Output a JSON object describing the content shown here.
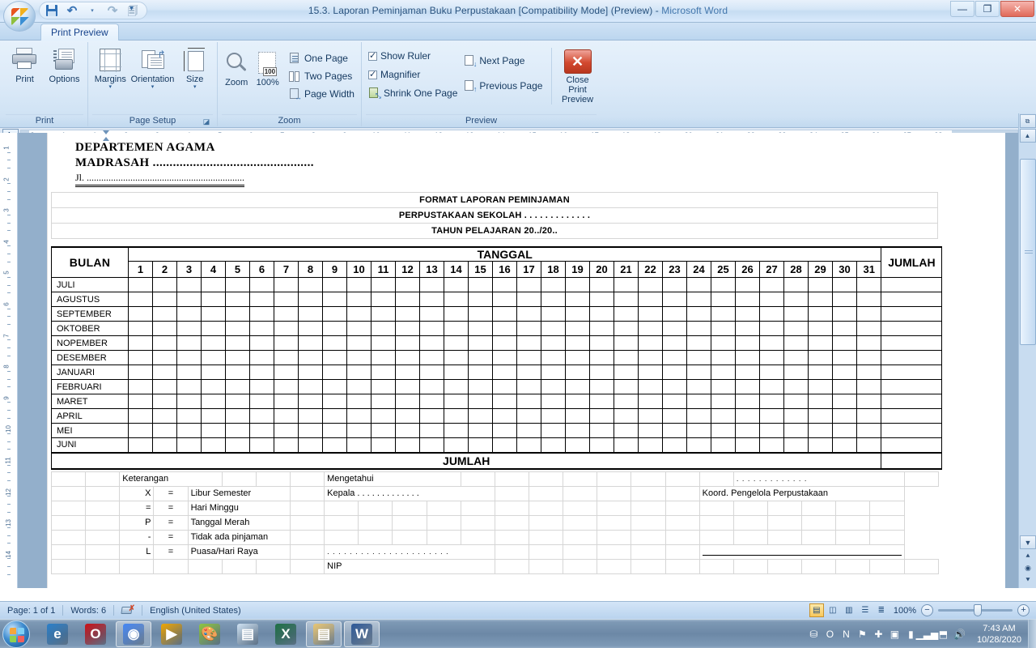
{
  "window": {
    "title": "15.3. Laporan Peminjaman Buku Perpustakaan [Compatibility Mode] (Preview) - ",
    "app_name": "Microsoft Word",
    "minimize": "—",
    "maximize": "❐",
    "close": "✕"
  },
  "quick_access": {
    "save": "save-icon",
    "undo": "↶",
    "undo_caret": "▾",
    "redo": "↷",
    "print_preview_qat": "print-preview-icon",
    "customize_caret": "▾"
  },
  "ribbon": {
    "tab": "Print Preview",
    "groups": [
      {
        "title": "Print",
        "buttons": [
          {
            "label": "Print",
            "icon": "printer-icon"
          },
          {
            "label": "Options",
            "icon": "print-options-icon"
          }
        ]
      },
      {
        "title": "Page Setup",
        "buttons": [
          {
            "label": "Margins",
            "icon": "margins-icon",
            "caret": "▾"
          },
          {
            "label": "Orientation",
            "icon": "orientation-icon",
            "caret": "▾"
          },
          {
            "label": "Size",
            "icon": "page-size-icon",
            "caret": "▾"
          }
        ],
        "dialog_launcher": "◪"
      },
      {
        "title": "Zoom",
        "buttons": [
          {
            "label": "Zoom",
            "icon": "zoom-icon"
          },
          {
            "label": "100%",
            "icon": "zoom-100-icon"
          }
        ],
        "small_buttons": [
          {
            "label": "One Page",
            "icon": "one-page-icon"
          },
          {
            "label": "Two Pages",
            "icon": "two-pages-icon"
          },
          {
            "label": "Page Width",
            "icon": "page-width-icon"
          }
        ]
      },
      {
        "title": "Preview",
        "checkboxes": [
          {
            "label": "Show Ruler",
            "checked": true
          },
          {
            "label": "Magnifier",
            "checked": true
          }
        ],
        "small_buttons": [
          {
            "label": "Shrink One Page",
            "icon": "shrink-one-page-icon"
          },
          {
            "label": "Next Page",
            "icon": "next-page-icon"
          },
          {
            "label": "Previous Page",
            "icon": "previous-page-icon"
          }
        ],
        "close_button": {
          "label_line1": "Close Print",
          "label_line2": "Preview",
          "glyph": "✕"
        }
      }
    ]
  },
  "ruler": {
    "tab_selector": "L",
    "h_labels": [
      "2",
      "1",
      "1",
      "2",
      "3",
      "4",
      "5",
      "6",
      "7",
      "8",
      "9",
      "10",
      "11",
      "12",
      "13",
      "14",
      "15",
      "16",
      "17",
      "18",
      "19",
      "20",
      "21",
      "22",
      "23",
      "24",
      "25",
      "26",
      "27",
      "28",
      "29",
      "30"
    ],
    "v_labels": [
      "1",
      "2",
      "3",
      "4",
      "5",
      "6",
      "7",
      "8",
      "9",
      "10",
      "11",
      "12",
      "13",
      "14"
    ]
  },
  "document": {
    "header": {
      "line1": "DEPARTEMEN AGAMA",
      "line2": "MADRASAH ................................................",
      "line3": "Jl. ................................................................."
    },
    "titles": [
      "FORMAT LAPORAN PEMINJAMAN",
      "PERPUSTAKAAN SEKOLAH . . . . . . . . . . . . .",
      "TAHUN PELAJARAN 20../20.."
    ],
    "table": {
      "col_bulan": "BULAN",
      "col_tanggal": "TANGGAL",
      "col_jumlah": "JUMLAH",
      "days": [
        "1",
        "2",
        "3",
        "4",
        "5",
        "6",
        "7",
        "8",
        "9",
        "10",
        "11",
        "12",
        "13",
        "14",
        "15",
        "16",
        "17",
        "18",
        "19",
        "20",
        "21",
        "22",
        "23",
        "24",
        "25",
        "26",
        "27",
        "28",
        "29",
        "30",
        "31"
      ],
      "months": [
        "JULI",
        "AGUSTUS",
        "SEPTEMBER",
        "OKTOBER",
        "NOPEMBER",
        "DESEMBER",
        "JANUARI",
        "FEBRUARI",
        "MARET",
        "APRIL",
        "MEI",
        "JUNI"
      ],
      "total_row": "JUMLAH"
    },
    "legend": {
      "heading": "Keterangan",
      "rows": [
        {
          "symbol": "X",
          "eq": "=",
          "meaning": "Libur Semester"
        },
        {
          "symbol": "=",
          "eq": "=",
          "meaning": "Hari Minggu"
        },
        {
          "symbol": "P",
          "eq": "=",
          "meaning": "Tanggal Merah"
        },
        {
          "symbol": "-",
          "eq": "=",
          "meaning": "Tidak ada pinjaman"
        },
        {
          "symbol": "L",
          "eq": "=",
          "meaning": "Puasa/Hari Raya"
        }
      ]
    },
    "signature_left": {
      "heading": "Mengetahui",
      "role": "Kepala . . . . . . . . . . . . .",
      "dots": ". . . . . . . . . . . . . . . . . . . . . .",
      "nip": "NIP"
    },
    "signature_right": {
      "dots": ". . . . . . . . . . . . .",
      "role": "Koord. Pengelola Perpustakaan"
    }
  },
  "status_bar": {
    "page": "Page: 1 of 1",
    "words": "Words: 6",
    "proofing_icon": "spelling-check-icon",
    "language": "English (United States)",
    "views": [
      "print-layout-icon",
      "full-screen-reading-icon",
      "web-layout-icon",
      "outline-icon",
      "draft-icon"
    ],
    "zoom_level": "100%",
    "zoom_out": "−",
    "zoom_in": "+"
  },
  "taskbar": {
    "start": "start-orb-icon",
    "apps": [
      {
        "name": "internet-explorer-icon",
        "glyph": "e",
        "color": "#2a7fc9",
        "active": false
      },
      {
        "name": "opera-icon",
        "glyph": "O",
        "color": "#cc0f16",
        "active": false
      },
      {
        "name": "google-chrome-icon",
        "glyph": "◉",
        "color": "#4285f4",
        "active": true
      },
      {
        "name": "media-player-icon",
        "glyph": "▶",
        "color": "#f0a500",
        "active": false
      },
      {
        "name": "paint-icon",
        "glyph": "🎨",
        "color": "#8ec63f",
        "active": false
      },
      {
        "name": "notepad-icon",
        "glyph": "▤",
        "color": "#cfe2f3",
        "active": false
      },
      {
        "name": "excel-icon",
        "glyph": "X",
        "color": "#1d7044",
        "active": false
      },
      {
        "name": "file-explorer-icon",
        "glyph": "▤",
        "color": "#e8c572",
        "active": true
      },
      {
        "name": "word-icon",
        "glyph": "W",
        "color": "#2b5797",
        "active": true
      }
    ],
    "tray": [
      {
        "name": "network-users-icon",
        "glyph": "⛁"
      },
      {
        "name": "opera-tray-icon",
        "glyph": "O"
      },
      {
        "name": "onenote-tray-icon",
        "glyph": "N"
      },
      {
        "name": "flag-action-center-icon",
        "glyph": "⚑"
      },
      {
        "name": "bluetooth-icon",
        "glyph": "✚"
      },
      {
        "name": "display-icon",
        "glyph": "▣"
      },
      {
        "name": "battery-icon",
        "glyph": "▮"
      },
      {
        "name": "signal-icon",
        "glyph": "▁▃▅"
      },
      {
        "name": "usb-safe-remove-icon",
        "glyph": "⬒"
      },
      {
        "name": "volume-icon",
        "glyph": "🔊"
      }
    ],
    "clock_time": "7:43 AM",
    "clock_date": "10/28/2020"
  }
}
